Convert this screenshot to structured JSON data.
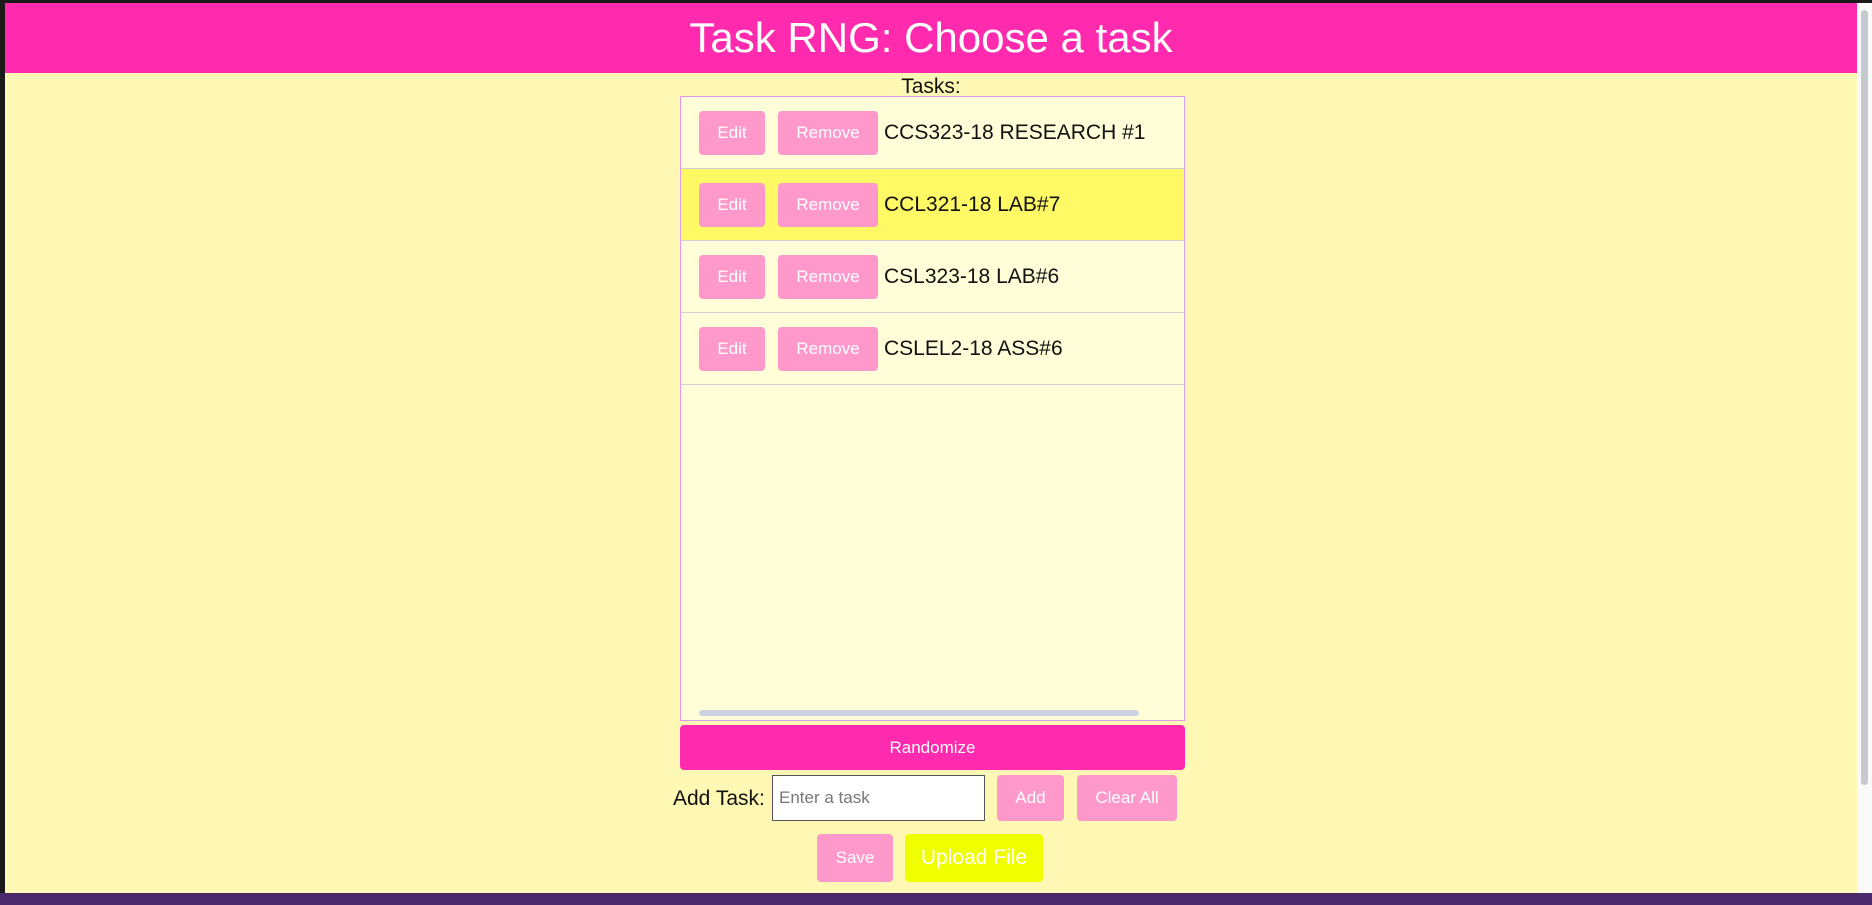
{
  "header": {
    "title": "Task RNG: Choose a task"
  },
  "task_list": {
    "label": "Tasks:",
    "edit_label": "Edit",
    "remove_label": "Remove",
    "items": [
      {
        "text": "CCS323-18 RESEARCH #1",
        "highlighted": false
      },
      {
        "text": "CCL321-18 LAB#7",
        "highlighted": true
      },
      {
        "text": "CSL323-18 LAB#6",
        "highlighted": false
      },
      {
        "text": "CSLEL2-18 ASS#6",
        "highlighted": false
      }
    ]
  },
  "controls": {
    "randomize_label": "Randomize",
    "add_task_label": "Add Task:",
    "input_placeholder": "Enter a task",
    "input_value": "",
    "add_label": "Add",
    "clear_all_label": "Clear All",
    "save_label": "Save",
    "upload_label": "Upload File"
  },
  "colors": {
    "header_bg": "#ff2aad",
    "page_bg": "#fff8b4",
    "list_bg": "#fffed8",
    "highlight_row": "#fff966",
    "button_pink": "#ff98cb",
    "upload_yellow": "#f0ff00"
  }
}
